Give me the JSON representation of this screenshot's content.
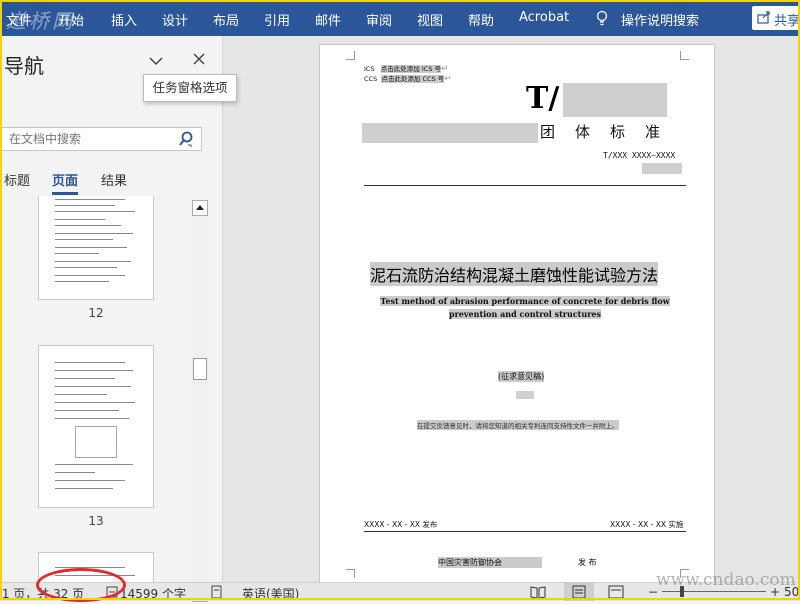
{
  "ribbon": {
    "tabs": [
      "文件",
      "开始",
      "插入",
      "设计",
      "布局",
      "引用",
      "邮件",
      "审阅",
      "视图",
      "帮助",
      "Acrobat"
    ],
    "tell_me": "操作说明搜索",
    "share_label": "共享",
    "watermark": "道桥网",
    "color": "#2b579a"
  },
  "nav": {
    "title": "导航",
    "tooltip": "任务窗格选项",
    "search_placeholder": "在文档中搜索",
    "tabs": [
      "标题",
      "页面",
      "结果"
    ],
    "active_tab": "页面",
    "thumbnails": [
      {
        "page": "12"
      },
      {
        "page": "13"
      },
      {
        "page": ""
      }
    ]
  },
  "document": {
    "ics": "ICS",
    "ics_hint": "点击此处添加 ICS 号",
    "ccs": "CCS",
    "ccs_hint": "点击此处添加 CCS 号",
    "t_prefix": "T/",
    "standard_type": "团体标准",
    "standard_no": "T/XXX XXXX—XXXX",
    "title_cn": "泥石流防治结构混凝土磨蚀性能试验方法",
    "title_en": "Test method of abrasion performance of concrete for debris flow prevention and control structures",
    "draft_status": "(征求意见稿)",
    "notice": "在提交反馈意见时，请将您知道的相关专利连同支持性文件一并附上。",
    "publish_date": "XXXX - XX - XX 发布",
    "implement_date": "XXXX - XX - XX 实施",
    "association": "中国灾害防御协会",
    "publish_label": "发 布"
  },
  "status": {
    "page_info": "第 1 页，共 32 页",
    "word_count": "14599 个字",
    "language": "英语(美国)",
    "zoom_hint": "50"
  },
  "site_watermark": "www.cndao.com",
  "annotation_color": "#e32a2a"
}
